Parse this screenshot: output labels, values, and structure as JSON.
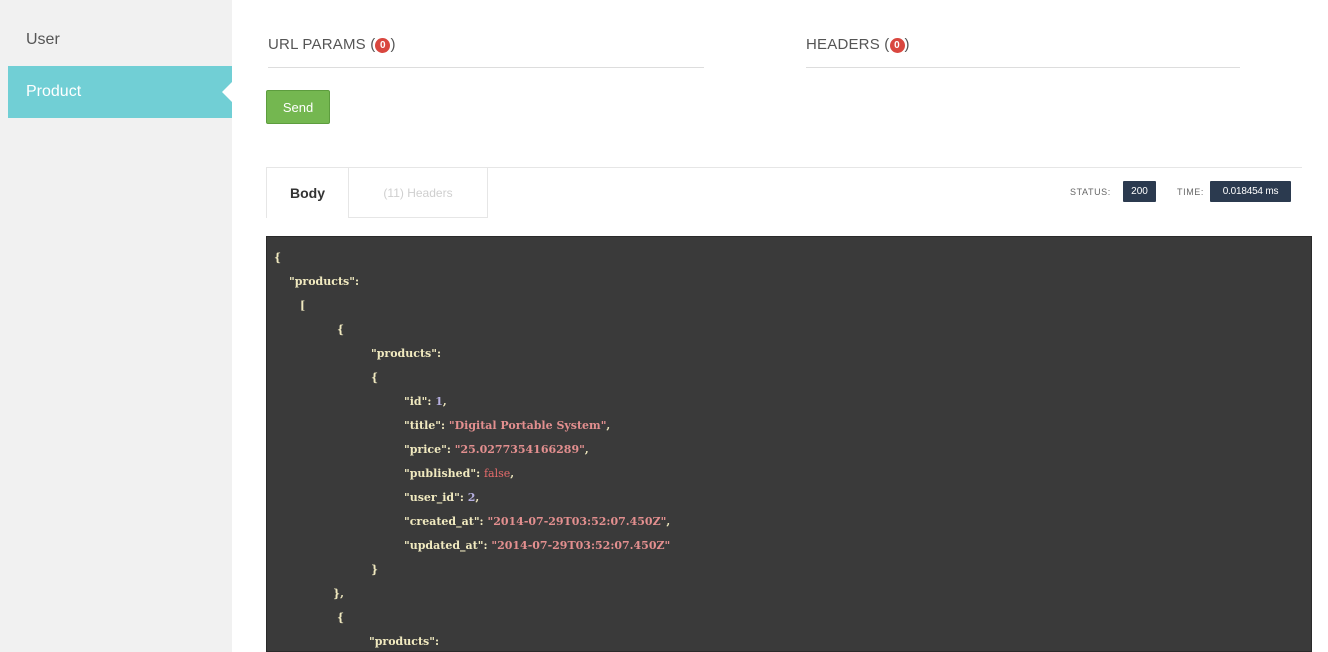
{
  "sidebar": {
    "items": [
      {
        "label": "User",
        "active": false
      },
      {
        "label": "Product",
        "active": true
      }
    ]
  },
  "params": {
    "url_label": "URL PARAMS",
    "url_count": "0",
    "headers_label": "HEADERS",
    "headers_count": "0"
  },
  "send_label": "Send",
  "response": {
    "tabs": [
      {
        "label": "Body",
        "active": true
      },
      {
        "label": "(11) Headers",
        "active": false
      }
    ],
    "status_label": "STATUS:",
    "status_value": "200",
    "time_label": "TIME:",
    "time_value": "0.018454 ms"
  },
  "code": {
    "open_brace": "{",
    "products_key": "\"products\":",
    "open_bracket": "[",
    "item1_open": "{",
    "item1_products_key": "\"products\":",
    "item1_inner_open": "{",
    "id_key": "\"id\":",
    "id_value": "1",
    "title_key": "\"title\":",
    "title_value": "\"Digital Portable System\"",
    "price_key": "\"price\":",
    "price_value": "\"25.0277354166289\"",
    "published_key": "\"published\":",
    "published_value": "false",
    "user_id_key": "\"user_id\":",
    "user_id_value": "2",
    "created_key": "\"created_at\":",
    "created_value": "\"2014-07-29T03:52:07.450Z\"",
    "updated_key": "\"updated_at\":",
    "updated_value": "\"2014-07-29T03:52:07.450Z\"",
    "item1_inner_close": "}",
    "item1_close": "},",
    "item2_open": "{",
    "item2_products_key": "\"products\":",
    "item2_inner_open": "{"
  },
  "colors": {
    "sidebar_active": "#71cfd5",
    "send_button": "#74b750",
    "badge": "#d9473f",
    "code_bg": "#3a3a3a",
    "meta_bg": "#2b3a4f"
  }
}
